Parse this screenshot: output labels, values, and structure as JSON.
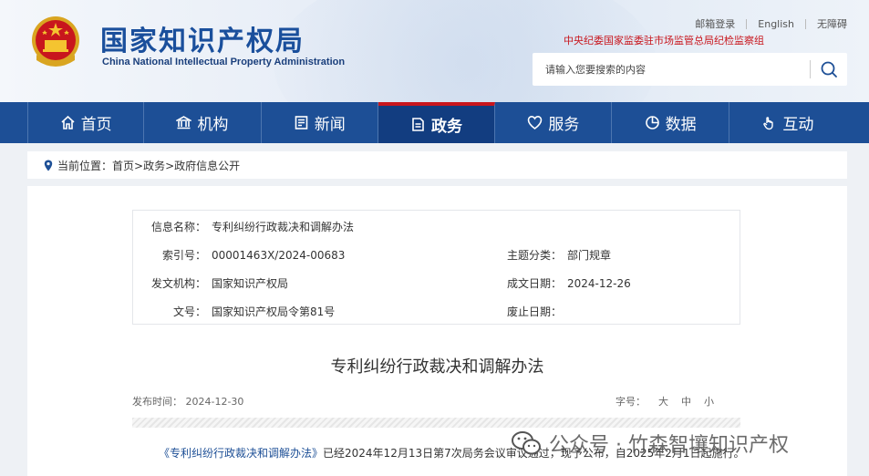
{
  "header": {
    "site_name_cn": "国家知识产权局",
    "site_name_en": "China National Intellectual Property Administration",
    "top_links": [
      "邮箱登录",
      "English",
      "无障碍"
    ],
    "supervise_text": "中央纪委国家监委驻市场监管总局纪检监察组",
    "search_placeholder": "请输入您要搜索的内容"
  },
  "nav": {
    "items": [
      {
        "label": "首页",
        "icon": "home-icon"
      },
      {
        "label": "机构",
        "icon": "institution-icon"
      },
      {
        "label": "新闻",
        "icon": "news-icon"
      },
      {
        "label": "政务",
        "icon": "government-icon"
      },
      {
        "label": "服务",
        "icon": "service-icon"
      },
      {
        "label": "数据",
        "icon": "data-icon"
      },
      {
        "label": "互动",
        "icon": "interaction-icon"
      }
    ],
    "active": "政务"
  },
  "breadcrumb": {
    "prefix": "当前位置：",
    "path": "首页>政务>政府信息公开"
  },
  "info": {
    "name_label": "信息名称：",
    "name_value": "专利纠纷行政裁决和调解办法",
    "index_label": "索引号：",
    "index_value": "00001463X/2024-00683",
    "category_label": "主题分类：",
    "category_value": "部门规章",
    "issuer_label": "发文机构：",
    "issuer_value": "国家知识产权局",
    "date_label": "成文日期：",
    "date_value": "2024-12-26",
    "docno_label": "文号：",
    "docno_value": "国家知识产权局令第81号",
    "abolish_label": "废止日期：",
    "abolish_value": ""
  },
  "document": {
    "title": "专利纠纷行政裁决和调解办法",
    "publish_label": "发布时间：",
    "publish_date": "2024-12-30",
    "font_label": "字号：",
    "font_options": [
      "大",
      "中",
      "小"
    ],
    "body_link": "《专利纠纷行政裁决和调解办法》",
    "body_rest": "已经2024年12月13日第7次局务会议审议通过，现予公布，自2025年2月1日起施行。"
  },
  "watermark": {
    "text": "公众号 · 竹森智壤知识产权"
  },
  "colors": {
    "nav_bg": "#1d4f96",
    "nav_active": "#123d80",
    "accent_red": "#c8161d",
    "brand_blue": "#1a4f9c"
  }
}
